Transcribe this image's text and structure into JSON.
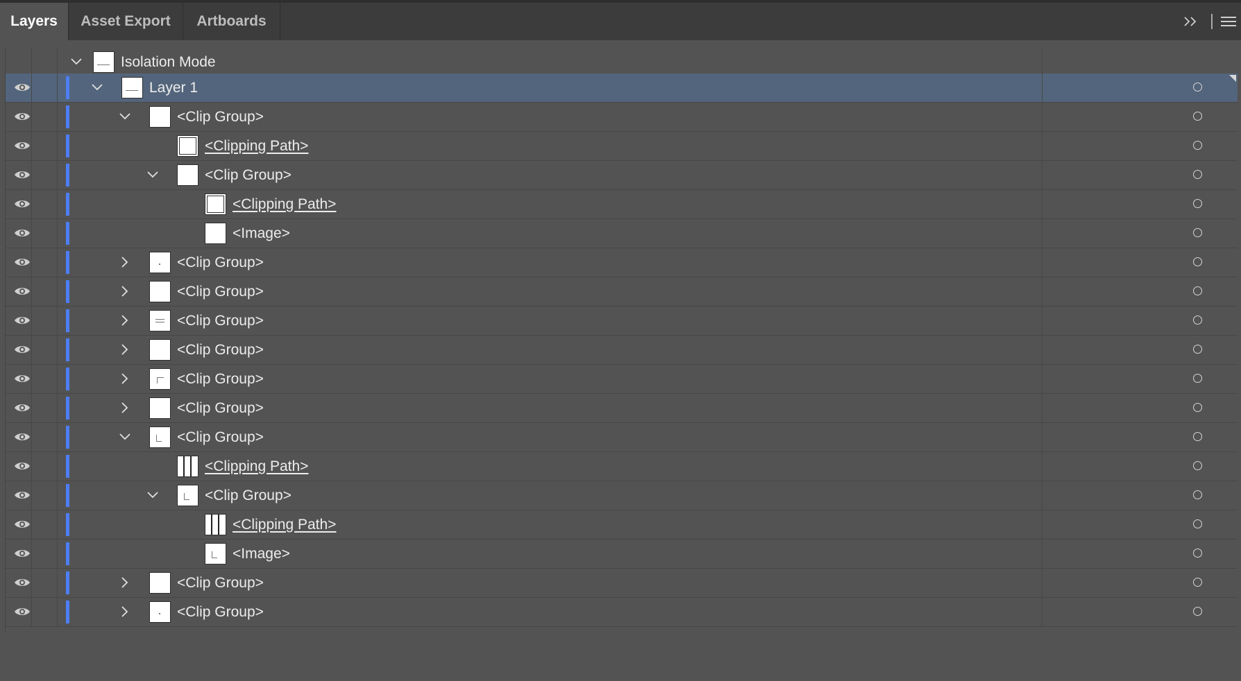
{
  "tabs": [
    {
      "label": "Layers",
      "active": true
    },
    {
      "label": "Asset Export",
      "active": false
    },
    {
      "label": "Artboards",
      "active": false
    }
  ],
  "toolbar": {
    "collapse_icon": "double-chevron-right-icon",
    "menu_icon": "hamburger-menu-icon"
  },
  "colors": {
    "layer_color": "#4d7ef5",
    "selected_row": "#53657c",
    "panel_bg": "#535353"
  },
  "isolation": {
    "label": "Isolation Mode",
    "expanded": true
  },
  "rows": [
    {
      "label": "Layer 1",
      "level": 0,
      "expanded": true,
      "selected": true,
      "underline": false,
      "thumb": "layer"
    },
    {
      "label": "<Clip Group>",
      "level": 1,
      "expanded": true,
      "underline": false,
      "thumb": "blank"
    },
    {
      "label": "<Clipping Path>",
      "level": 2,
      "expanded": null,
      "underline": true,
      "thumb": "clip"
    },
    {
      "label": "<Clip Group>",
      "level": 2,
      "expanded": true,
      "underline": false,
      "thumb": "blank"
    },
    {
      "label": "<Clipping Path>",
      "level": 3,
      "expanded": null,
      "underline": true,
      "thumb": "clip"
    },
    {
      "label": "<Image>",
      "level": 3,
      "expanded": null,
      "underline": false,
      "thumb": "blank"
    },
    {
      "label": "<Clip Group>",
      "level": 1,
      "expanded": false,
      "underline": false,
      "thumb": "dot"
    },
    {
      "label": "<Clip Group>",
      "level": 1,
      "expanded": false,
      "underline": false,
      "thumb": "blank"
    },
    {
      "label": "<Clip Group>",
      "level": 1,
      "expanded": false,
      "underline": false,
      "thumb": "lines"
    },
    {
      "label": "<Clip Group>",
      "level": 1,
      "expanded": false,
      "underline": false,
      "thumb": "blank"
    },
    {
      "label": "<Clip Group>",
      "level": 1,
      "expanded": false,
      "underline": false,
      "thumb": "corner"
    },
    {
      "label": "<Clip Group>",
      "level": 1,
      "expanded": false,
      "underline": false,
      "thumb": "blank"
    },
    {
      "label": "<Clip Group>",
      "level": 1,
      "expanded": true,
      "underline": false,
      "thumb": "small"
    },
    {
      "label": "<Clipping Path>",
      "level": 2,
      "expanded": null,
      "underline": true,
      "thumb": "bars"
    },
    {
      "label": "<Clip Group>",
      "level": 2,
      "expanded": true,
      "underline": false,
      "thumb": "small"
    },
    {
      "label": "<Clipping Path>",
      "level": 3,
      "expanded": null,
      "underline": true,
      "thumb": "bars"
    },
    {
      "label": "<Image>",
      "level": 3,
      "expanded": null,
      "underline": false,
      "thumb": "small"
    },
    {
      "label": "<Clip Group>",
      "level": 1,
      "expanded": false,
      "underline": false,
      "thumb": "blank"
    },
    {
      "label": "<Clip Group>",
      "level": 1,
      "expanded": false,
      "underline": false,
      "thumb": "dot"
    }
  ]
}
